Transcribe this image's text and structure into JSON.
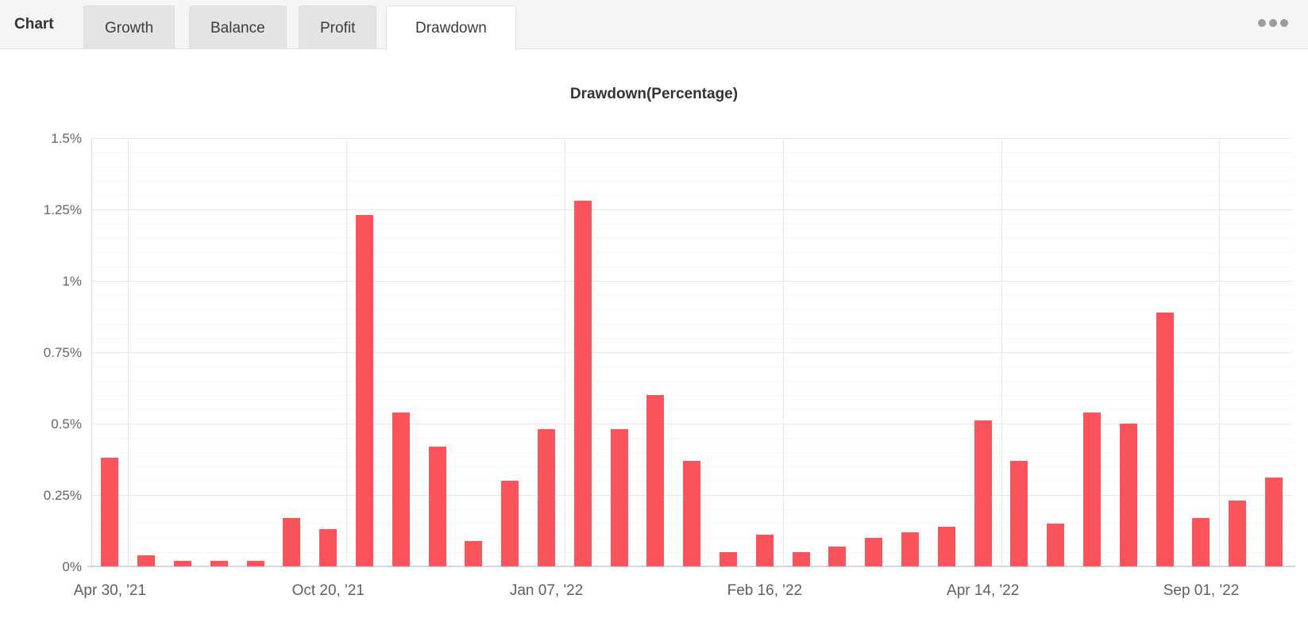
{
  "tab_bar": {
    "title": "Chart",
    "tabs": [
      {
        "label": "Growth",
        "active": false
      },
      {
        "label": "Balance",
        "active": false
      },
      {
        "label": "Profit",
        "active": false
      },
      {
        "label": "Drawdown",
        "active": true
      }
    ],
    "overflow_menu_icon": "ellipsis-icon"
  },
  "chart_data": {
    "type": "bar",
    "title": "Drawdown(Percentage)",
    "values": [
      0.38,
      0.04,
      0.02,
      0.02,
      0.02,
      0.17,
      0.13,
      1.23,
      0.54,
      0.42,
      0.09,
      0.3,
      0.48,
      1.28,
      0.48,
      0.6,
      0.37,
      0.05,
      0.11,
      0.05,
      0.07,
      0.1,
      0.12,
      0.14,
      0.51,
      0.37,
      0.15,
      0.54,
      0.5,
      0.89,
      0.17,
      0.23,
      0.31
    ],
    "x_tick_labels": [
      "Apr 30, '21",
      "Oct 20, '21",
      "Jan 07, '22",
      "Feb 16, '22",
      "Apr 14, '22",
      "Sep 01, '22"
    ],
    "x_tick_indices": [
      0,
      6,
      12,
      18,
      24,
      30
    ],
    "y_tick_labels": [
      "0%",
      "0.25%",
      "0.5%",
      "0.75%",
      "1%",
      "1.25%",
      "1.5%"
    ],
    "y_tick_values": [
      0,
      0.25,
      0.5,
      0.75,
      1,
      1.25,
      1.5
    ],
    "ylim": [
      0,
      1.5
    ],
    "y_minor_step": 0.05,
    "bar_color": "#fa555c",
    "grid": true,
    "legend_position": "none"
  }
}
